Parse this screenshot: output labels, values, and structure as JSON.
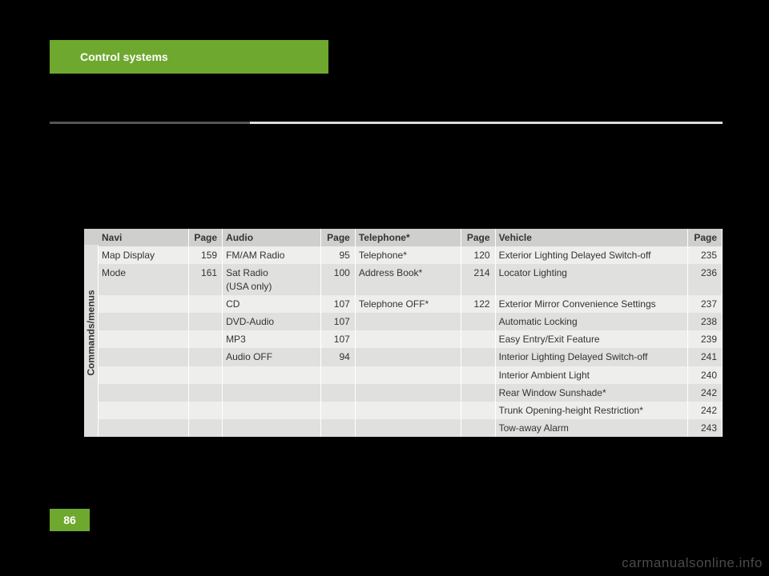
{
  "header": {
    "title": "Control systems"
  },
  "page_number": "86",
  "watermark": "carmanualsonline.info",
  "sidebar_label": "Commands/menus",
  "columns": {
    "navi": "Navi",
    "audio": "Audio",
    "telephone": "Telephone*",
    "vehicle": "Vehicle",
    "page": "Page"
  },
  "rows": [
    {
      "navi": "Map Display",
      "navi_p": "159",
      "audio": "FM/AM Radio",
      "audio_p": "95",
      "tel": "Telephone*",
      "tel_p": "120",
      "veh": "Exterior Lighting Delayed Switch-off",
      "veh_p": "235"
    },
    {
      "navi": "Mode",
      "navi_p": "161",
      "audio": "Sat Radio\n(USA only)",
      "audio_p": "100",
      "tel": "Address Book*",
      "tel_p": "214",
      "veh": "Locator Lighting",
      "veh_p": "236"
    },
    {
      "navi": "",
      "navi_p": "",
      "audio": "CD",
      "audio_p": "107",
      "tel": "Telephone OFF*",
      "tel_p": "122",
      "veh": "Exterior Mirror Convenience Settings",
      "veh_p": "237"
    },
    {
      "navi": "",
      "navi_p": "",
      "audio": "DVD-Audio",
      "audio_p": "107",
      "tel": "",
      "tel_p": "",
      "veh": "Automatic Locking",
      "veh_p": "238"
    },
    {
      "navi": "",
      "navi_p": "",
      "audio": "MP3",
      "audio_p": "107",
      "tel": "",
      "tel_p": "",
      "veh": "Easy Entry/Exit Feature",
      "veh_p": "239"
    },
    {
      "navi": "",
      "navi_p": "",
      "audio": "Audio OFF",
      "audio_p": "94",
      "tel": "",
      "tel_p": "",
      "veh": "Interior Lighting Delayed Switch-off",
      "veh_p": "241"
    },
    {
      "navi": "",
      "navi_p": "",
      "audio": "",
      "audio_p": "",
      "tel": "",
      "tel_p": "",
      "veh": "Interior Ambient Light",
      "veh_p": "240"
    },
    {
      "navi": "",
      "navi_p": "",
      "audio": "",
      "audio_p": "",
      "tel": "",
      "tel_p": "",
      "veh": "Rear Window Sunshade*",
      "veh_p": "242"
    },
    {
      "navi": "",
      "navi_p": "",
      "audio": "",
      "audio_p": "",
      "tel": "",
      "tel_p": "",
      "veh": "Trunk Opening-height Restriction*",
      "veh_p": "242"
    },
    {
      "navi": "",
      "navi_p": "",
      "audio": "",
      "audio_p": "",
      "tel": "",
      "tel_p": "",
      "veh": "Tow-away Alarm",
      "veh_p": "243"
    }
  ]
}
